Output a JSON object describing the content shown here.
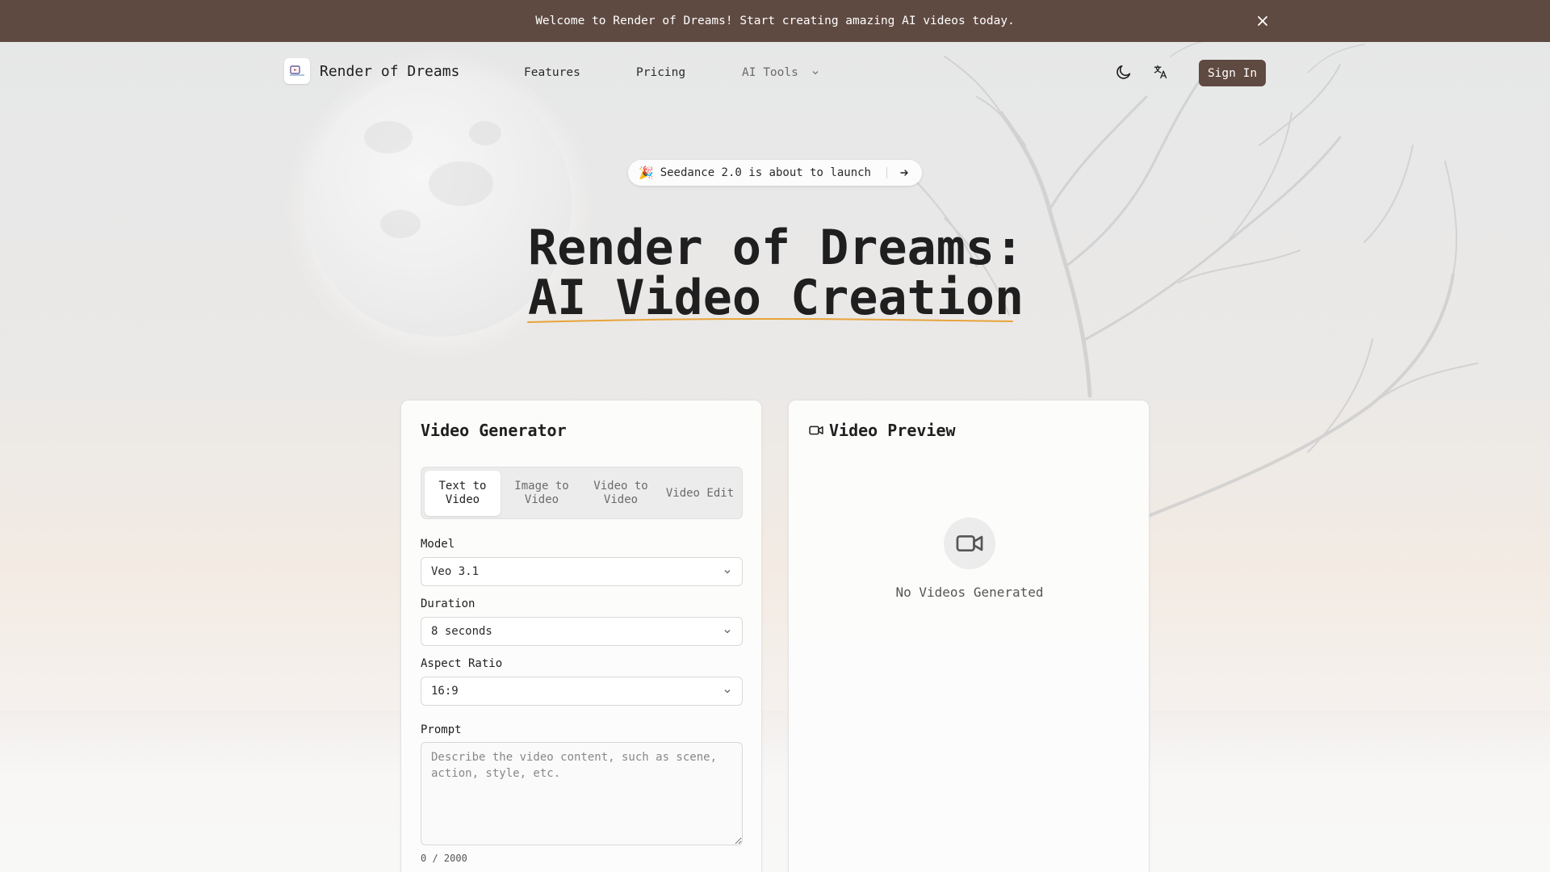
{
  "banner": {
    "message": "Welcome to Render of Dreams! Start creating amazing AI videos today.",
    "close_icon": "close-icon"
  },
  "nav": {
    "brand": "Render of Dreams",
    "links": {
      "features": "Features",
      "pricing": "Pricing",
      "ai_tools": "AI Tools"
    },
    "theme_icon": "moon-icon",
    "language_icon": "translate-icon",
    "sign_in": "Sign In"
  },
  "hero": {
    "announcement_emoji": "🎉",
    "announcement": "Seedance 2.0 is about to launch",
    "title_line1": "Render of Dreams:",
    "title_line2": "AI Video Creation"
  },
  "generator": {
    "title": "Video Generator",
    "tabs": [
      {
        "label": "Text to Video",
        "active": true
      },
      {
        "label": "Image to Video",
        "active": false
      },
      {
        "label": "Video to Video",
        "active": false
      },
      {
        "label": "Video Edit",
        "active": false
      }
    ],
    "model": {
      "label": "Model",
      "value": "Veo 3.1"
    },
    "duration": {
      "label": "Duration",
      "value": "8 seconds"
    },
    "aspect_ratio": {
      "label": "Aspect Ratio",
      "value": "16:9"
    },
    "prompt": {
      "label": "Prompt",
      "placeholder": "Describe the video content, such as scene, action, style, etc.",
      "counter": "0 / 2000"
    }
  },
  "preview": {
    "title": "Video Preview",
    "empty_text": "No Videos Generated"
  },
  "colors": {
    "brand_brown": "#5f4a42",
    "underline_accent": "#e8a33a"
  }
}
